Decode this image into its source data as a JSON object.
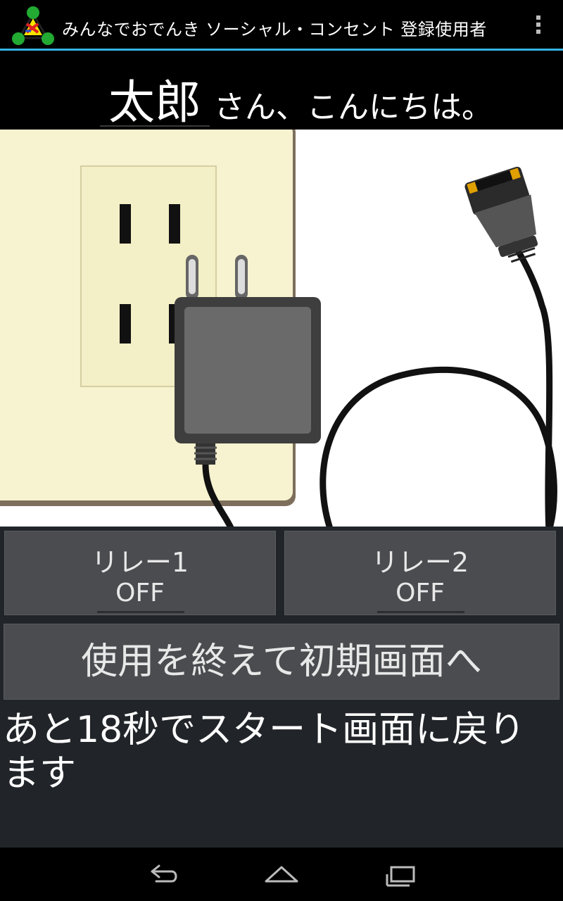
{
  "app": {
    "title": "みんなでおでんき ソーシャル・コンセント 登録使用者",
    "accent_color": "#33b5e5",
    "logo_icon": "molecule-logo-icon",
    "menu_icon": "overflow-menu-icon"
  },
  "greeting": {
    "user_name": "太郎",
    "suffix": "さん、こんにちは。"
  },
  "illustration": {
    "image_icon": "outlet-with-charger-plug-illustration"
  },
  "relays": [
    {
      "label": "リレー1",
      "state": "OFF"
    },
    {
      "label": "リレー2",
      "state": "OFF"
    }
  ],
  "end_button": {
    "label": "使用を終えて初期画面へ"
  },
  "countdown": {
    "text": "あと18秒でスタート画面に戻ります"
  },
  "nav": {
    "back_icon": "back-icon",
    "home_icon": "home-icon",
    "recents_icon": "recents-icon"
  }
}
